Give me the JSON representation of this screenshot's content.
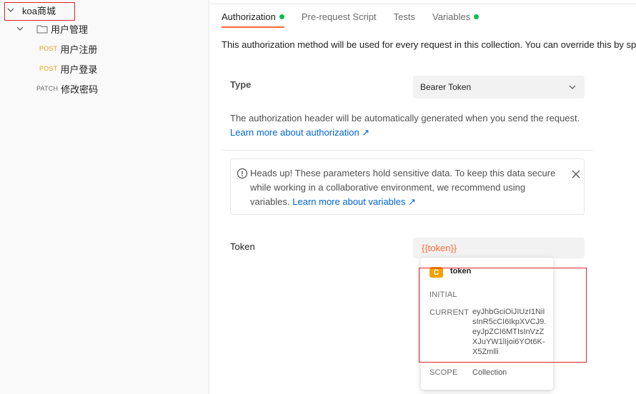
{
  "sidebar": {
    "collection_name": "koa商城",
    "folder_name": "用户管理",
    "requests": [
      {
        "method": "POST",
        "name": "用户注册"
      },
      {
        "method": "POST",
        "name": "用户登录"
      },
      {
        "method": "PATCH",
        "name": "修改密码"
      }
    ]
  },
  "tabs": [
    {
      "label": "Authorization",
      "active": true,
      "dot": true
    },
    {
      "label": "Pre-request Script",
      "active": false,
      "dot": false
    },
    {
      "label": "Tests",
      "active": false,
      "dot": false
    },
    {
      "label": "Variables",
      "active": false,
      "dot": true
    }
  ],
  "auth": {
    "info_line": "This authorization method will be used for every request in this collection. You can override this by spe",
    "type_label": "Type",
    "type_value": "Bearer Token",
    "desc": "The authorization header will be automatically generated when you send the request.",
    "learn_link": "Learn more about authorization ↗",
    "alert_text": "Heads up! These parameters hold sensitive data. To keep this data secure while working in a collaborative environment, we recommend using variables.",
    "alert_link": "Learn more about variables ↗",
    "token_label": "Token",
    "token_value": "{{token}}"
  },
  "variable_popover": {
    "badge": "C",
    "name": "token",
    "initial_label": "INITIAL",
    "current_label": "CURRENT",
    "current_value": "eyJhbGciOiJIUzI1NiIsInR5cCI6IkpXVCJ9.eyJpZCI6MTIsInVzZXJuYW1lIjoi6YOt6K-X5Zmlli",
    "scope_label": "SCOPE",
    "scope_value": "Collection"
  },
  "colors": {
    "accent": "#ff6c37",
    "link": "#0265d2",
    "dot_green": "#0cbb52",
    "post": "#e8a317",
    "badge": "#f2a100",
    "annotation_box": "#e0242a"
  },
  "icons": [
    "chevron-down-icon",
    "folder-icon",
    "info-icon",
    "close-icon"
  ]
}
